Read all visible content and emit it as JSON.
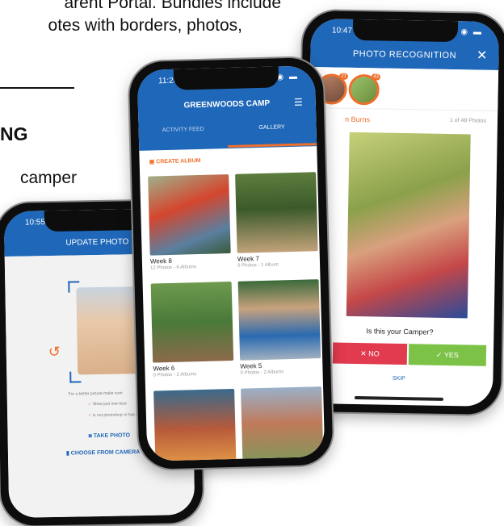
{
  "background": {
    "line1": "arent Portal. Bundles include",
    "line2": "otes with borders, photos,",
    "heading": "NG",
    "line3": "camper"
  },
  "phone_recognition": {
    "time": "10:47",
    "title": "PHOTO RECOGNITION",
    "close": "✕",
    "thumb_badge_1": "21",
    "thumb_badge_2": "43",
    "camper_name": "n Burns",
    "photo_count": "1 of 48 Photos",
    "question": "Is this your Camper?",
    "no_label": "✕  NO",
    "yes_label": "✓  YES",
    "skip_label": "SKIP"
  },
  "phone_update": {
    "time": "10:55",
    "title": "UPDATE PHOTO",
    "hint": "For a better picture make sure",
    "check1": "Show just one face",
    "check2": "Is not photoshop or has pose",
    "take_photo": "TAKE PHOTO",
    "choose_camera": "CHOOSE FROM CAMERA"
  },
  "phone_gallery": {
    "time": "11:26",
    "title": "GREENWOODS CAMP",
    "tabs": [
      "ACTIVITY FEED",
      "GALLERY"
    ],
    "create_album": "CREATE ALBUM",
    "albums": [
      {
        "name": "Week 8",
        "sub": "12 Photos - 6 Albums"
      },
      {
        "name": "Week 7",
        "sub": "0 Photos - 1 Album"
      },
      {
        "name": "Week 6",
        "sub": "0 Photos - 2 Albums"
      },
      {
        "name": "Week 5",
        "sub": "0 Photos - 2 Albums"
      }
    ]
  },
  "colors": {
    "brand_blue": "#1f67b8",
    "accent_orange": "#ef6f2c",
    "no_red": "#e23a4e",
    "yes_green": "#7bc247"
  }
}
